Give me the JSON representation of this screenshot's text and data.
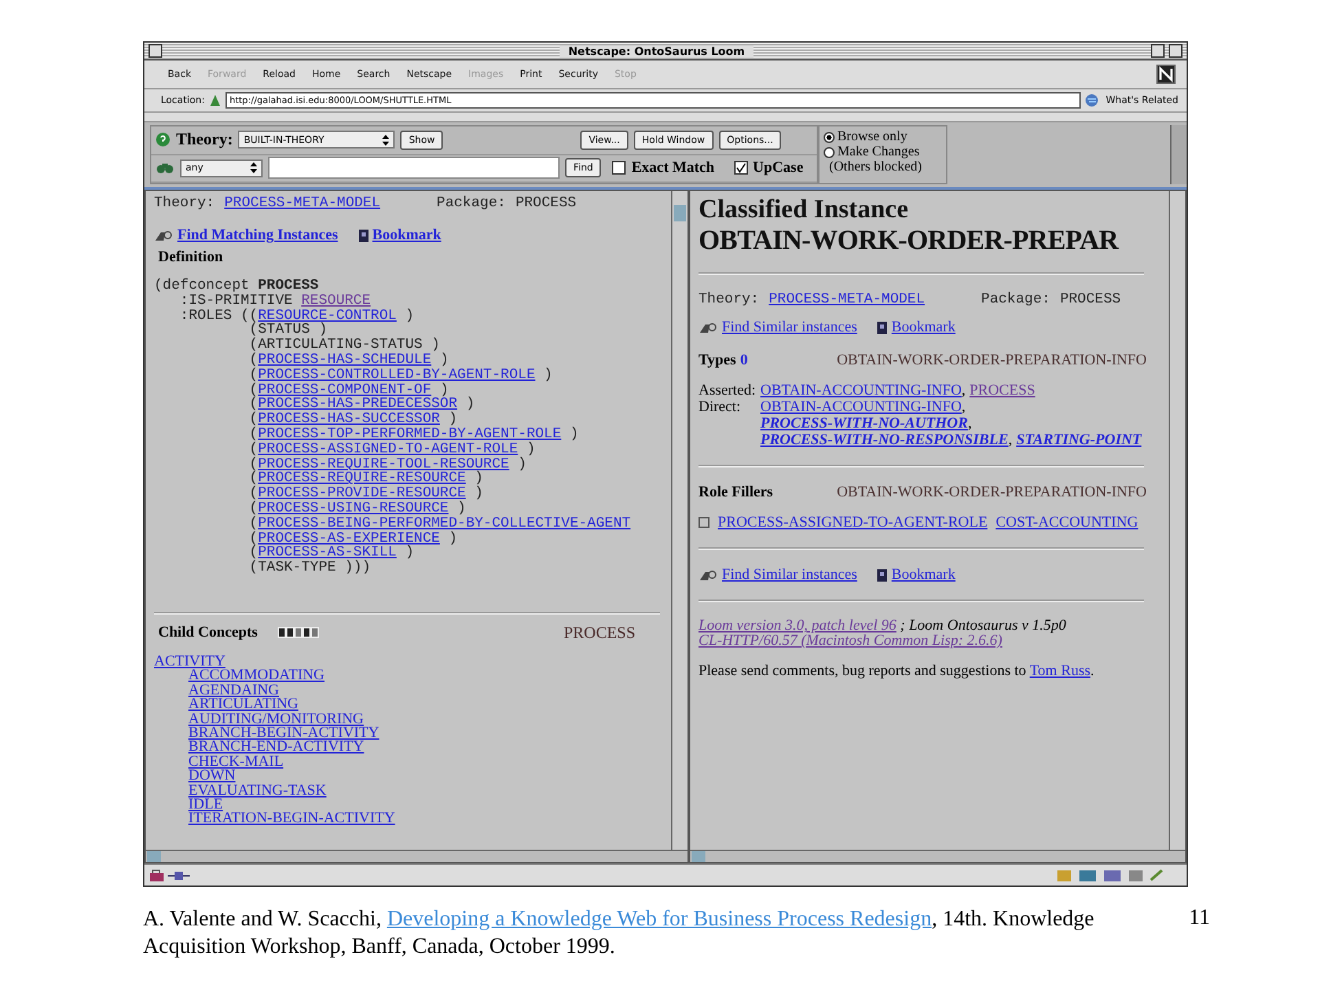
{
  "window": {
    "title": "Netscape: OntoSaurus Loom"
  },
  "toolbar": [
    {
      "label": "Back",
      "disabled": false
    },
    {
      "label": "Forward",
      "disabled": true
    },
    {
      "label": "Reload",
      "disabled": false
    },
    {
      "label": "Home",
      "disabled": false
    },
    {
      "label": "Search",
      "disabled": false
    },
    {
      "label": "Netscape",
      "disabled": false
    },
    {
      "label": "Images",
      "disabled": true
    },
    {
      "label": "Print",
      "disabled": false
    },
    {
      "label": "Security",
      "disabled": false
    },
    {
      "label": "Stop",
      "disabled": true
    }
  ],
  "location": {
    "label": "Location:",
    "value": "http://galahad.isi.edu:8000/LOOM/SHUTTLE.HTML",
    "related": "What's Related"
  },
  "loom_bar": {
    "theory_label": "Theory:",
    "theory": "BUILT-IN-THEORY",
    "show": "Show",
    "buttons": [
      "View...",
      "Hold Window",
      "Options..."
    ],
    "scope": "any",
    "find": "Find",
    "options": [
      {
        "label": "Exact Match",
        "checked": false
      },
      {
        "label": "UpCase",
        "checked": true
      }
    ],
    "modes": [
      {
        "label": "Browse only",
        "selected": true
      },
      {
        "label": "Make Changes",
        "selected": false
      }
    ],
    "modes_note": "(Others blocked)"
  },
  "left_frame": {
    "theory_label": "Theory:",
    "theory": {
      "text": "PROCESS-META-MODEL",
      "visited": false
    },
    "package_label": "Package:",
    "package": "PROCESS",
    "find": "Find Matching Instances",
    "bookmark": "Bookmark",
    "definition_heading": "Definition",
    "definition": [
      {
        "kind": "concept",
        "text": "(defconcept **PROCESS**"
      },
      {
        "kind": "attribute",
        "text": ":IS-PRIMITIVE ",
        "link": {
          "text": "RESOURCE",
          "visited": true
        }
      },
      {
        "kind": "attribute",
        "text": ":ROLES ((",
        "link": {
          "text": "RESOURCE-CONTROL",
          "visited": false
        },
        "tail": " )"
      },
      {
        "kind": "role",
        "text": "(STATUS )"
      },
      {
        "kind": "role",
        "text": "(ARTICULATING-STATUS )"
      },
      {
        "kind": "role",
        "text": "(",
        "link": {
          "text": "PROCESS-HAS-SCHEDULE",
          "visited": false
        },
        "tail": " )"
      },
      {
        "kind": "role",
        "text": "(",
        "link": {
          "text": "PROCESS-CONTROLLED-BY-AGENT-ROLE",
          "visited": false
        },
        "tail": " )"
      },
      {
        "kind": "role",
        "text": "(",
        "link": {
          "text": "PROCESS-COMPONENT-OF",
          "visited": false
        },
        "tail": " )"
      },
      {
        "kind": "role",
        "text": "(",
        "link": {
          "text": "PROCESS-HAS-PREDECESSOR",
          "visited": false
        },
        "tail": " )"
      },
      {
        "kind": "role",
        "text": "(",
        "link": {
          "text": "PROCESS-HAS-SUCCESSOR",
          "visited": false
        },
        "tail": " )"
      },
      {
        "kind": "role",
        "text": "(",
        "link": {
          "text": "PROCESS-TOP-PERFORMED-BY-AGENT-ROLE",
          "visited": false
        },
        "tail": " )"
      },
      {
        "kind": "role",
        "text": "(",
        "link": {
          "text": "PROCESS-ASSIGNED-TO-AGENT-ROLE",
          "visited": false
        },
        "tail": " )"
      },
      {
        "kind": "role",
        "text": "(",
        "link": {
          "text": "PROCESS-REQUIRE-TOOL-RESOURCE",
          "visited": false
        },
        "tail": " )"
      },
      {
        "kind": "role",
        "text": "(",
        "link": {
          "text": "PROCESS-REQUIRE-RESOURCE",
          "visited": false
        },
        "tail": " )"
      },
      {
        "kind": "role",
        "text": "(",
        "link": {
          "text": "PROCESS-PROVIDE-RESOURCE",
          "visited": false
        },
        "tail": " )"
      },
      {
        "kind": "role",
        "text": "(",
        "link": {
          "text": "PROCESS-USING-RESOURCE",
          "visited": false
        },
        "tail": " )"
      },
      {
        "kind": "role",
        "text": "(",
        "link": {
          "text": "PROCESS-BEING-PERFORMED-BY-COLLECTIVE-AGENT",
          "visited": false
        }
      },
      {
        "kind": "role",
        "text": "(",
        "link": {
          "text": "PROCESS-AS-EXPERIENCE",
          "visited": false
        },
        "tail": " )"
      },
      {
        "kind": "role",
        "text": "(",
        "link": {
          "text": "PROCESS-AS-SKILL",
          "visited": false
        },
        "tail": " )"
      },
      {
        "kind": "role",
        "text": "(TASK-TYPE )))"
      }
    ],
    "child_heading": "Child Concepts",
    "child_of": "PROCESS",
    "children": [
      {
        "label": "ACTIVITY",
        "children": [
          {
            "label": "ACCOMMODATING"
          },
          {
            "label": "AGENDAING"
          },
          {
            "label": "ARTICULATING"
          },
          {
            "label": "AUDITING/MONITORING"
          },
          {
            "label": "BRANCH-BEGIN-ACTIVITY"
          },
          {
            "label": "BRANCH-END-ACTIVITY"
          },
          {
            "label": "CHECK-MAIL"
          },
          {
            "label": "DOWN"
          },
          {
            "label": "EVALUATING-TASK"
          },
          {
            "label": "IDLE"
          },
          {
            "label": "ITERATION-BEGIN-ACTIVITY"
          }
        ]
      }
    ]
  },
  "right_frame": {
    "heading": "Classified Instance",
    "instance": "OBTAIN-WORK-ORDER-PREPAR",
    "theory_label": "Theory:",
    "theory": {
      "text": "PROCESS-META-MODEL",
      "visited": false
    },
    "package_label": "Package:",
    "package": "PROCESS",
    "find": "Find Similar instances",
    "bookmark": "Bookmark",
    "types_label": "Types",
    "types_count": "0",
    "types_value": "OBTAIN-WORK-ORDER-PREPARATION-INFO",
    "asserted_label": "Asserted:",
    "asserted": [
      {
        "text": "OBTAIN-ACCOUNTING-INFO",
        "visited": false
      },
      {
        "text": "PROCESS",
        "visited": true
      }
    ],
    "direct_label": "Direct:",
    "direct": [
      {
        "text": "OBTAIN-ACCOUNTING-INFO",
        "italic": false
      },
      {
        "text": "PROCESS-WITH-NO-AUTHOR",
        "italic": true
      },
      {
        "text": "PROCESS-WITH-NO-RESPONSIBLE",
        "italic": true
      },
      {
        "text": "STARTING-POINT",
        "italic": true
      }
    ],
    "separator": ",",
    "role_label": "Role Fillers",
    "role_value": "OBTAIN-WORK-ORDER-PREPARATION-INFO",
    "role_links": [
      "PROCESS-ASSIGNED-TO-AGENT-ROLE",
      "COST-ACCOUNTING"
    ],
    "find2": "Find Similar instances",
    "bookmark2": "Bookmark",
    "version_link": "Loom version 3.0, patch level 96",
    "version_text": " ; Loom Ontosaurus v 1.5p0",
    "server_link": "CL-HTTP/60.57 (Macintosh Common Lisp: 2.6.6)",
    "contact_text": "Please send comments, bug reports and suggestions to ",
    "contact_link": "Tom Russ",
    "contact_end": "."
  },
  "caption": {
    "before": "A. Valente and W. Scacchi, ",
    "link": "Developing a Knowledge Web for Business Process Redesign",
    "after": ", 14th. Knowledge Acquisition Workshop, Banff, Canada, October 1999.",
    "page": "11"
  }
}
